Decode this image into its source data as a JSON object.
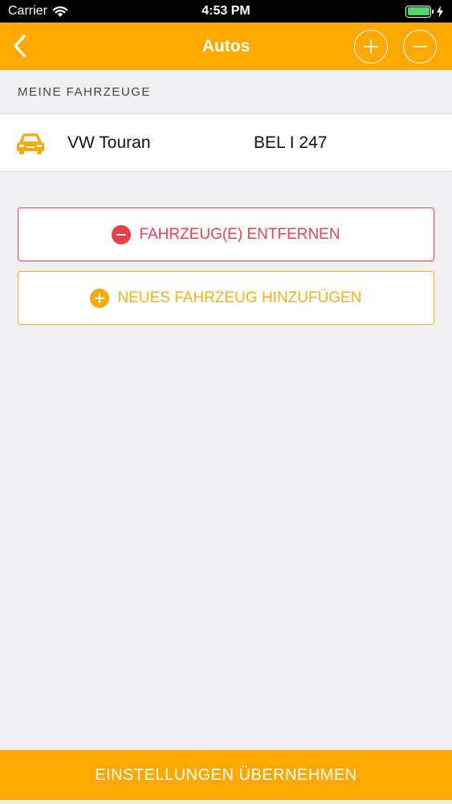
{
  "status_bar": {
    "carrier": "Carrier",
    "time": "4:53 PM"
  },
  "nav": {
    "title": "Autos"
  },
  "section": {
    "header": "MEINE FAHRZEUGE"
  },
  "vehicles": [
    {
      "name": "VW Touran",
      "plate": "BEL I 247"
    }
  ],
  "actions": {
    "remove_label": "FAHRZEUG(E) ENTFERNEN",
    "add_label": "NEUES FAHRZEUG HINZUFÜGEN"
  },
  "bottom": {
    "apply_label": "EINSTELLUNGEN ÜBERNEHMEN"
  },
  "colors": {
    "brand": "#fea800",
    "danger": "#e8434f",
    "accent": "#f2b21b",
    "battery": "#4cd964"
  }
}
